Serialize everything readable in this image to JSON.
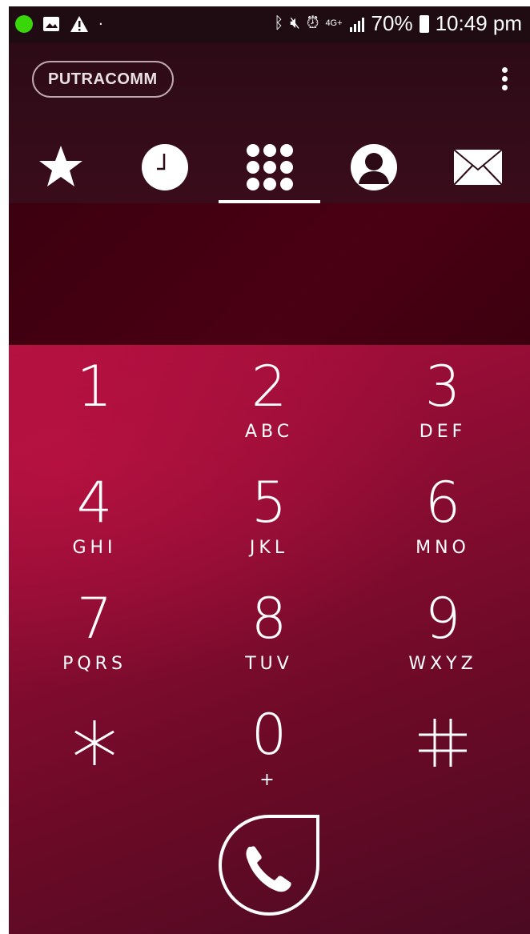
{
  "status_bar": {
    "battery": "70%",
    "time": "10:49 pm",
    "network": "4G+"
  },
  "header": {
    "brand": "PUTRACOMM",
    "tabs": [
      {
        "name": "favorites",
        "icon": "star-icon"
      },
      {
        "name": "recents",
        "icon": "clock-icon"
      },
      {
        "name": "keypad",
        "icon": "dialpad-icon",
        "active": true
      },
      {
        "name": "contacts",
        "icon": "person-icon"
      },
      {
        "name": "messages",
        "icon": "envelope-icon"
      }
    ]
  },
  "keypad": {
    "keys": [
      {
        "num": "1",
        "letters": ""
      },
      {
        "num": "2",
        "letters": "ABC"
      },
      {
        "num": "3",
        "letters": "DEF"
      },
      {
        "num": "4",
        "letters": "GHI"
      },
      {
        "num": "5",
        "letters": "JKL"
      },
      {
        "num": "6",
        "letters": "MNO"
      },
      {
        "num": "7",
        "letters": "PQRS"
      },
      {
        "num": "8",
        "letters": "TUV"
      },
      {
        "num": "9",
        "letters": "WXYZ"
      },
      {
        "num": "*",
        "letters": ""
      },
      {
        "num": "0",
        "letters": "+"
      },
      {
        "num": "#",
        "letters": ""
      }
    ]
  },
  "colors": {
    "accent": "#b0103f",
    "status_dot": "#39d60a"
  }
}
